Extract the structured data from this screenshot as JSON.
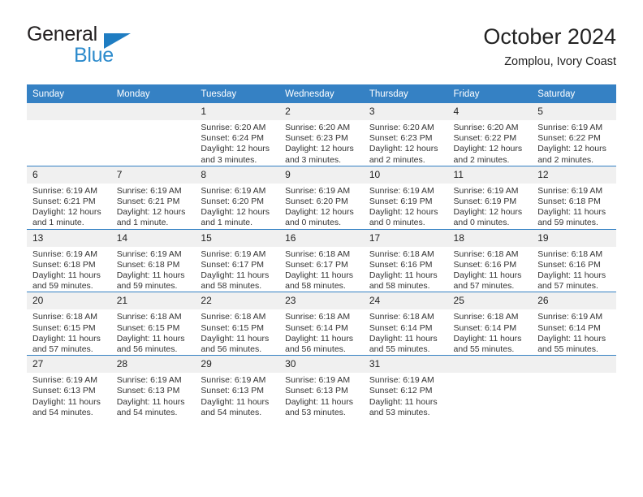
{
  "brand": {
    "line1": "General",
    "line2": "Blue",
    "triangle_color": "#1f7dc2",
    "line2_color": "#2d8bcc"
  },
  "header": {
    "title": "October 2024",
    "subtitle": "Zomplou, Ivory Coast"
  },
  "theme": {
    "header_bg": "#3581c4",
    "header_text": "#ffffff",
    "daynum_bg": "#f0f0f0",
    "row_divider": "#3581c4",
    "body_text": "#333333"
  },
  "calendar": {
    "weekday_headers": [
      "Sunday",
      "Monday",
      "Tuesday",
      "Wednesday",
      "Thursday",
      "Friday",
      "Saturday"
    ],
    "weeks": [
      [
        {
          "day": ""
        },
        {
          "day": ""
        },
        {
          "day": "1",
          "sunrise": "Sunrise: 6:20 AM",
          "sunset": "Sunset: 6:24 PM",
          "daylight1": "Daylight: 12 hours",
          "daylight2": "and 3 minutes."
        },
        {
          "day": "2",
          "sunrise": "Sunrise: 6:20 AM",
          "sunset": "Sunset: 6:23 PM",
          "daylight1": "Daylight: 12 hours",
          "daylight2": "and 3 minutes."
        },
        {
          "day": "3",
          "sunrise": "Sunrise: 6:20 AM",
          "sunset": "Sunset: 6:23 PM",
          "daylight1": "Daylight: 12 hours",
          "daylight2": "and 2 minutes."
        },
        {
          "day": "4",
          "sunrise": "Sunrise: 6:20 AM",
          "sunset": "Sunset: 6:22 PM",
          "daylight1": "Daylight: 12 hours",
          "daylight2": "and 2 minutes."
        },
        {
          "day": "5",
          "sunrise": "Sunrise: 6:19 AM",
          "sunset": "Sunset: 6:22 PM",
          "daylight1": "Daylight: 12 hours",
          "daylight2": "and 2 minutes."
        }
      ],
      [
        {
          "day": "6",
          "sunrise": "Sunrise: 6:19 AM",
          "sunset": "Sunset: 6:21 PM",
          "daylight1": "Daylight: 12 hours",
          "daylight2": "and 1 minute."
        },
        {
          "day": "7",
          "sunrise": "Sunrise: 6:19 AM",
          "sunset": "Sunset: 6:21 PM",
          "daylight1": "Daylight: 12 hours",
          "daylight2": "and 1 minute."
        },
        {
          "day": "8",
          "sunrise": "Sunrise: 6:19 AM",
          "sunset": "Sunset: 6:20 PM",
          "daylight1": "Daylight: 12 hours",
          "daylight2": "and 1 minute."
        },
        {
          "day": "9",
          "sunrise": "Sunrise: 6:19 AM",
          "sunset": "Sunset: 6:20 PM",
          "daylight1": "Daylight: 12 hours",
          "daylight2": "and 0 minutes."
        },
        {
          "day": "10",
          "sunrise": "Sunrise: 6:19 AM",
          "sunset": "Sunset: 6:19 PM",
          "daylight1": "Daylight: 12 hours",
          "daylight2": "and 0 minutes."
        },
        {
          "day": "11",
          "sunrise": "Sunrise: 6:19 AM",
          "sunset": "Sunset: 6:19 PM",
          "daylight1": "Daylight: 12 hours",
          "daylight2": "and 0 minutes."
        },
        {
          "day": "12",
          "sunrise": "Sunrise: 6:19 AM",
          "sunset": "Sunset: 6:18 PM",
          "daylight1": "Daylight: 11 hours",
          "daylight2": "and 59 minutes."
        }
      ],
      [
        {
          "day": "13",
          "sunrise": "Sunrise: 6:19 AM",
          "sunset": "Sunset: 6:18 PM",
          "daylight1": "Daylight: 11 hours",
          "daylight2": "and 59 minutes."
        },
        {
          "day": "14",
          "sunrise": "Sunrise: 6:19 AM",
          "sunset": "Sunset: 6:18 PM",
          "daylight1": "Daylight: 11 hours",
          "daylight2": "and 59 minutes."
        },
        {
          "day": "15",
          "sunrise": "Sunrise: 6:19 AM",
          "sunset": "Sunset: 6:17 PM",
          "daylight1": "Daylight: 11 hours",
          "daylight2": "and 58 minutes."
        },
        {
          "day": "16",
          "sunrise": "Sunrise: 6:18 AM",
          "sunset": "Sunset: 6:17 PM",
          "daylight1": "Daylight: 11 hours",
          "daylight2": "and 58 minutes."
        },
        {
          "day": "17",
          "sunrise": "Sunrise: 6:18 AM",
          "sunset": "Sunset: 6:16 PM",
          "daylight1": "Daylight: 11 hours",
          "daylight2": "and 58 minutes."
        },
        {
          "day": "18",
          "sunrise": "Sunrise: 6:18 AM",
          "sunset": "Sunset: 6:16 PM",
          "daylight1": "Daylight: 11 hours",
          "daylight2": "and 57 minutes."
        },
        {
          "day": "19",
          "sunrise": "Sunrise: 6:18 AM",
          "sunset": "Sunset: 6:16 PM",
          "daylight1": "Daylight: 11 hours",
          "daylight2": "and 57 minutes."
        }
      ],
      [
        {
          "day": "20",
          "sunrise": "Sunrise: 6:18 AM",
          "sunset": "Sunset: 6:15 PM",
          "daylight1": "Daylight: 11 hours",
          "daylight2": "and 57 minutes."
        },
        {
          "day": "21",
          "sunrise": "Sunrise: 6:18 AM",
          "sunset": "Sunset: 6:15 PM",
          "daylight1": "Daylight: 11 hours",
          "daylight2": "and 56 minutes."
        },
        {
          "day": "22",
          "sunrise": "Sunrise: 6:18 AM",
          "sunset": "Sunset: 6:15 PM",
          "daylight1": "Daylight: 11 hours",
          "daylight2": "and 56 minutes."
        },
        {
          "day": "23",
          "sunrise": "Sunrise: 6:18 AM",
          "sunset": "Sunset: 6:14 PM",
          "daylight1": "Daylight: 11 hours",
          "daylight2": "and 56 minutes."
        },
        {
          "day": "24",
          "sunrise": "Sunrise: 6:18 AM",
          "sunset": "Sunset: 6:14 PM",
          "daylight1": "Daylight: 11 hours",
          "daylight2": "and 55 minutes."
        },
        {
          "day": "25",
          "sunrise": "Sunrise: 6:18 AM",
          "sunset": "Sunset: 6:14 PM",
          "daylight1": "Daylight: 11 hours",
          "daylight2": "and 55 minutes."
        },
        {
          "day": "26",
          "sunrise": "Sunrise: 6:19 AM",
          "sunset": "Sunset: 6:14 PM",
          "daylight1": "Daylight: 11 hours",
          "daylight2": "and 55 minutes."
        }
      ],
      [
        {
          "day": "27",
          "sunrise": "Sunrise: 6:19 AM",
          "sunset": "Sunset: 6:13 PM",
          "daylight1": "Daylight: 11 hours",
          "daylight2": "and 54 minutes."
        },
        {
          "day": "28",
          "sunrise": "Sunrise: 6:19 AM",
          "sunset": "Sunset: 6:13 PM",
          "daylight1": "Daylight: 11 hours",
          "daylight2": "and 54 minutes."
        },
        {
          "day": "29",
          "sunrise": "Sunrise: 6:19 AM",
          "sunset": "Sunset: 6:13 PM",
          "daylight1": "Daylight: 11 hours",
          "daylight2": "and 54 minutes."
        },
        {
          "day": "30",
          "sunrise": "Sunrise: 6:19 AM",
          "sunset": "Sunset: 6:13 PM",
          "daylight1": "Daylight: 11 hours",
          "daylight2": "and 53 minutes."
        },
        {
          "day": "31",
          "sunrise": "Sunrise: 6:19 AM",
          "sunset": "Sunset: 6:12 PM",
          "daylight1": "Daylight: 11 hours",
          "daylight2": "and 53 minutes."
        },
        {
          "day": ""
        },
        {
          "day": ""
        }
      ]
    ]
  }
}
